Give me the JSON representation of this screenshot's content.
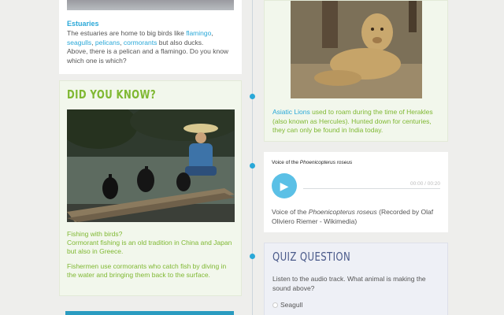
{
  "estuaries": {
    "title": "Estuaries",
    "line1_pre": "The estuaries are home to big birds like ",
    "link_flamingo": "flamingo",
    "sep1": ",",
    "link_seagulls": "seagulls",
    "sep2": ", ",
    "link_pelicans": "pelicans",
    "sep3": ", ",
    "link_cormorants": "cormorants",
    "line1_post": " but also ducks.",
    "line2": "Above, there is a pelican and a flamingo. Do you know which one is which?"
  },
  "did_you_know": {
    "heading": "DID YOU KNOW?",
    "caption_title": "Fishing with birds?",
    "caption_1": "Cormorant fishing is an old tradition in China and Japan but also in Greece.",
    "caption_2": "Fishermen use cormorants who catch fish by diving in the water and bringing them back to the surface."
  },
  "lion": {
    "link": "Asiatic Lions",
    "caption": " used to roam during the time of Herakles (also known as Hercules). Hunted down for centuries, they can only be found in India today."
  },
  "audio": {
    "label_pre": "Voice of the ",
    "label_species": "Phoenicopterus roseus",
    "time": "00:00 / 00:20",
    "desc_pre": "Voice of the ",
    "desc_species": "Phoenicopterus roseus",
    "desc_post": " (Recorded by Olaf Oliviero Riemer - Wikimedia)"
  },
  "quiz": {
    "heading": "QUIZ QUESTION",
    "question": "Listen to the audio track. What animal is making the sound above?",
    "option_1": "Seagull"
  },
  "colors": {
    "accent_blue": "#2aa8d8",
    "accent_green": "#7fb832",
    "quiz_navy": "#4a5a8a"
  }
}
